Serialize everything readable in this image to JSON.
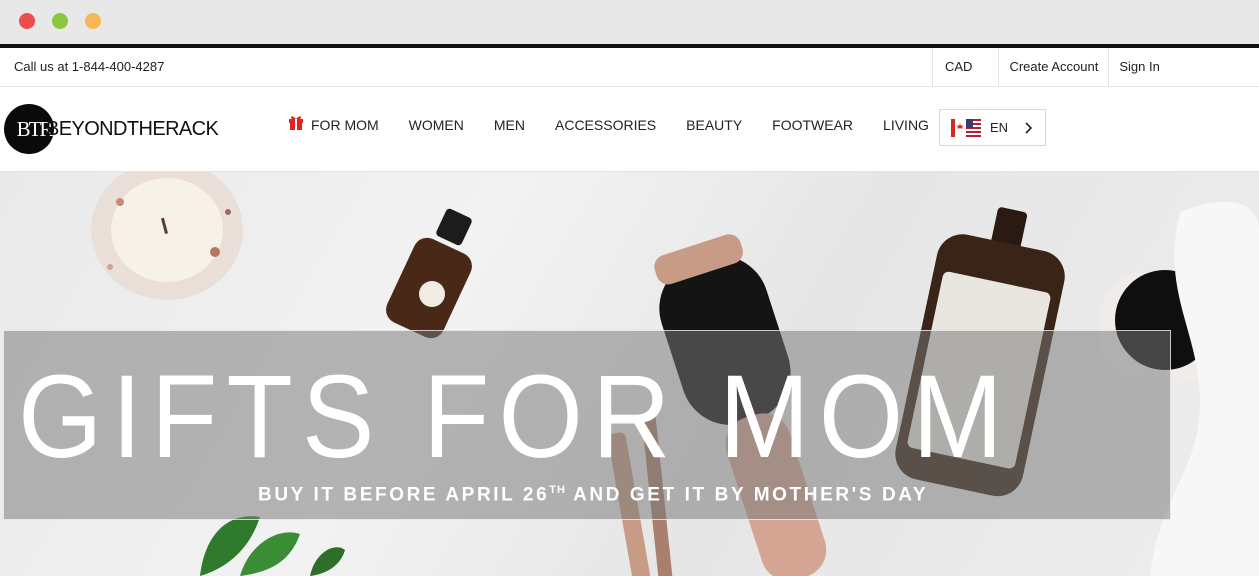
{
  "topbar": {
    "phone": "Call us at 1-844-400-4287",
    "currency": "CAD",
    "create_account": "Create Account",
    "sign_in": "Sign In"
  },
  "header": {
    "logo_badge": "BTR",
    "logo_text": "BEYONDTHERACK",
    "nav": [
      {
        "label": "FOR MOM",
        "icon": "gift-icon"
      },
      {
        "label": "WOMEN"
      },
      {
        "label": "MEN"
      },
      {
        "label": "ACCESSORIES"
      },
      {
        "label": "BEAUTY"
      },
      {
        "label": "FOOTWEAR"
      },
      {
        "label": "LIVING"
      }
    ],
    "language": {
      "label": "EN",
      "icon": "canada-us-flag-icon"
    }
  },
  "hero": {
    "headline": "GIFTS FOR MOM",
    "subline_pre": "BUY IT BEFORE APRIL 26",
    "subline_sup": "TH",
    "subline_post": " AND GET IT BY MOTHER'S DAY"
  },
  "colors": {
    "gift_icon": "#e02424",
    "dot_red": "#ee4c4c",
    "dot_green": "#8cc63f",
    "dot_yellow": "#f7b756"
  }
}
